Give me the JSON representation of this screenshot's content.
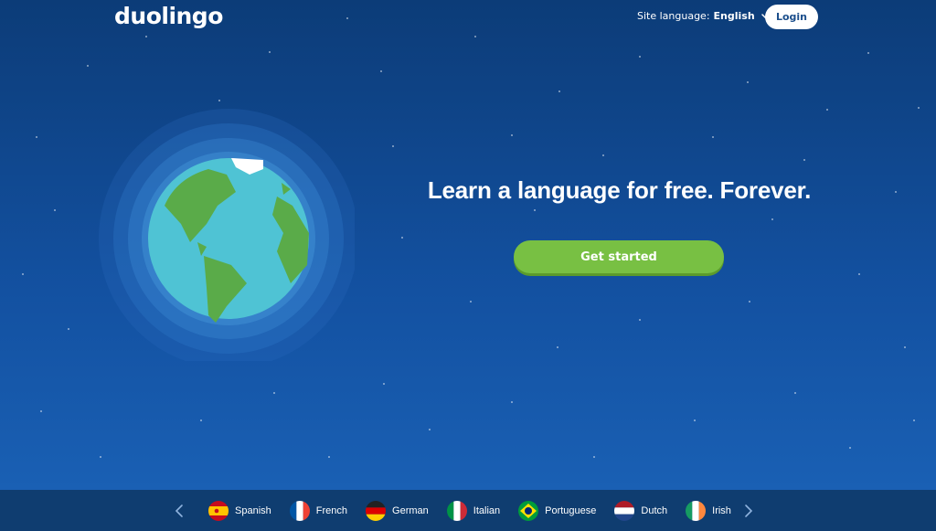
{
  "header": {
    "logo_text": "duolingo",
    "site_language_label": "Site language:",
    "site_language_value": "English",
    "login_label": "Login"
  },
  "hero": {
    "headline": "Learn a language for free. Forever.",
    "cta_label": "Get started"
  },
  "languages": [
    {
      "name": "Spanish"
    },
    {
      "name": "French"
    },
    {
      "name": "German"
    },
    {
      "name": "Italian"
    },
    {
      "name": "Portuguese"
    },
    {
      "name": "Dutch"
    },
    {
      "name": "Irish"
    }
  ],
  "colors": {
    "background_top": "#0c3c78",
    "background_bottom": "#1b63b8",
    "cta_green": "#78c043",
    "language_bar": "#0f3d70"
  },
  "icons": [
    "chevron-down-icon",
    "chevron-left-icon",
    "chevron-right-icon",
    "globe-illustration"
  ]
}
